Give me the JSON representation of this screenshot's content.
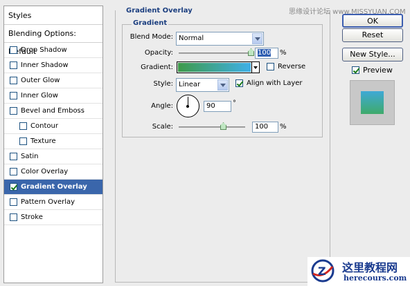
{
  "styles_panel": {
    "header": "Styles",
    "blending_options": "Blending Options: Default",
    "items": [
      {
        "label": "Drop Shadow",
        "checked": false
      },
      {
        "label": "Inner Shadow",
        "checked": false
      },
      {
        "label": "Outer Glow",
        "checked": false
      },
      {
        "label": "Inner Glow",
        "checked": false
      },
      {
        "label": "Bevel and Emboss",
        "checked": false
      },
      {
        "label": "Contour",
        "checked": false
      },
      {
        "label": "Texture",
        "checked": false
      },
      {
        "label": "Satin",
        "checked": false
      },
      {
        "label": "Color Overlay",
        "checked": false
      },
      {
        "label": "Gradient Overlay",
        "checked": true,
        "selected": true
      },
      {
        "label": "Pattern Overlay",
        "checked": false
      },
      {
        "label": "Stroke",
        "checked": false
      }
    ]
  },
  "gradient_overlay": {
    "outer_title": "Gradient Overlay",
    "inner_title": "Gradient",
    "blend_mode_label": "Blend Mode:",
    "blend_mode_value": "Normal",
    "opacity_label": "Opacity:",
    "opacity_value": "100",
    "opacity_level_percent": 100,
    "percent_sign": "%",
    "gradient_label": "Gradient:",
    "gradient_colors": [
      "#3f9a4a",
      "#3fb0e8"
    ],
    "reverse_label": "Reverse",
    "reverse_checked": false,
    "style_label": "Style:",
    "style_value": "Linear",
    "align_label": "Align with Layer",
    "align_checked": true,
    "angle_label": "Angle:",
    "angle_value": "90",
    "degree_sign": "°",
    "scale_label": "Scale:",
    "scale_value": "100",
    "scale_level_percent": 100
  },
  "buttons": {
    "ok": "OK",
    "reset": "Reset",
    "new_style": "New Style...",
    "preview_label": "Preview",
    "preview_checked": true
  },
  "overlay": {
    "watermark": "思缘设计论坛 www.MISSYUAN.COM",
    "logo_cn": "这里教程网",
    "logo_url": "herecours.com"
  },
  "colors": {
    "selected_bg": "#3a66ab",
    "group_title": "#1c3f80",
    "preview_swatch_top": "#3fa9d6",
    "preview_swatch_bottom": "#3faa6a"
  }
}
